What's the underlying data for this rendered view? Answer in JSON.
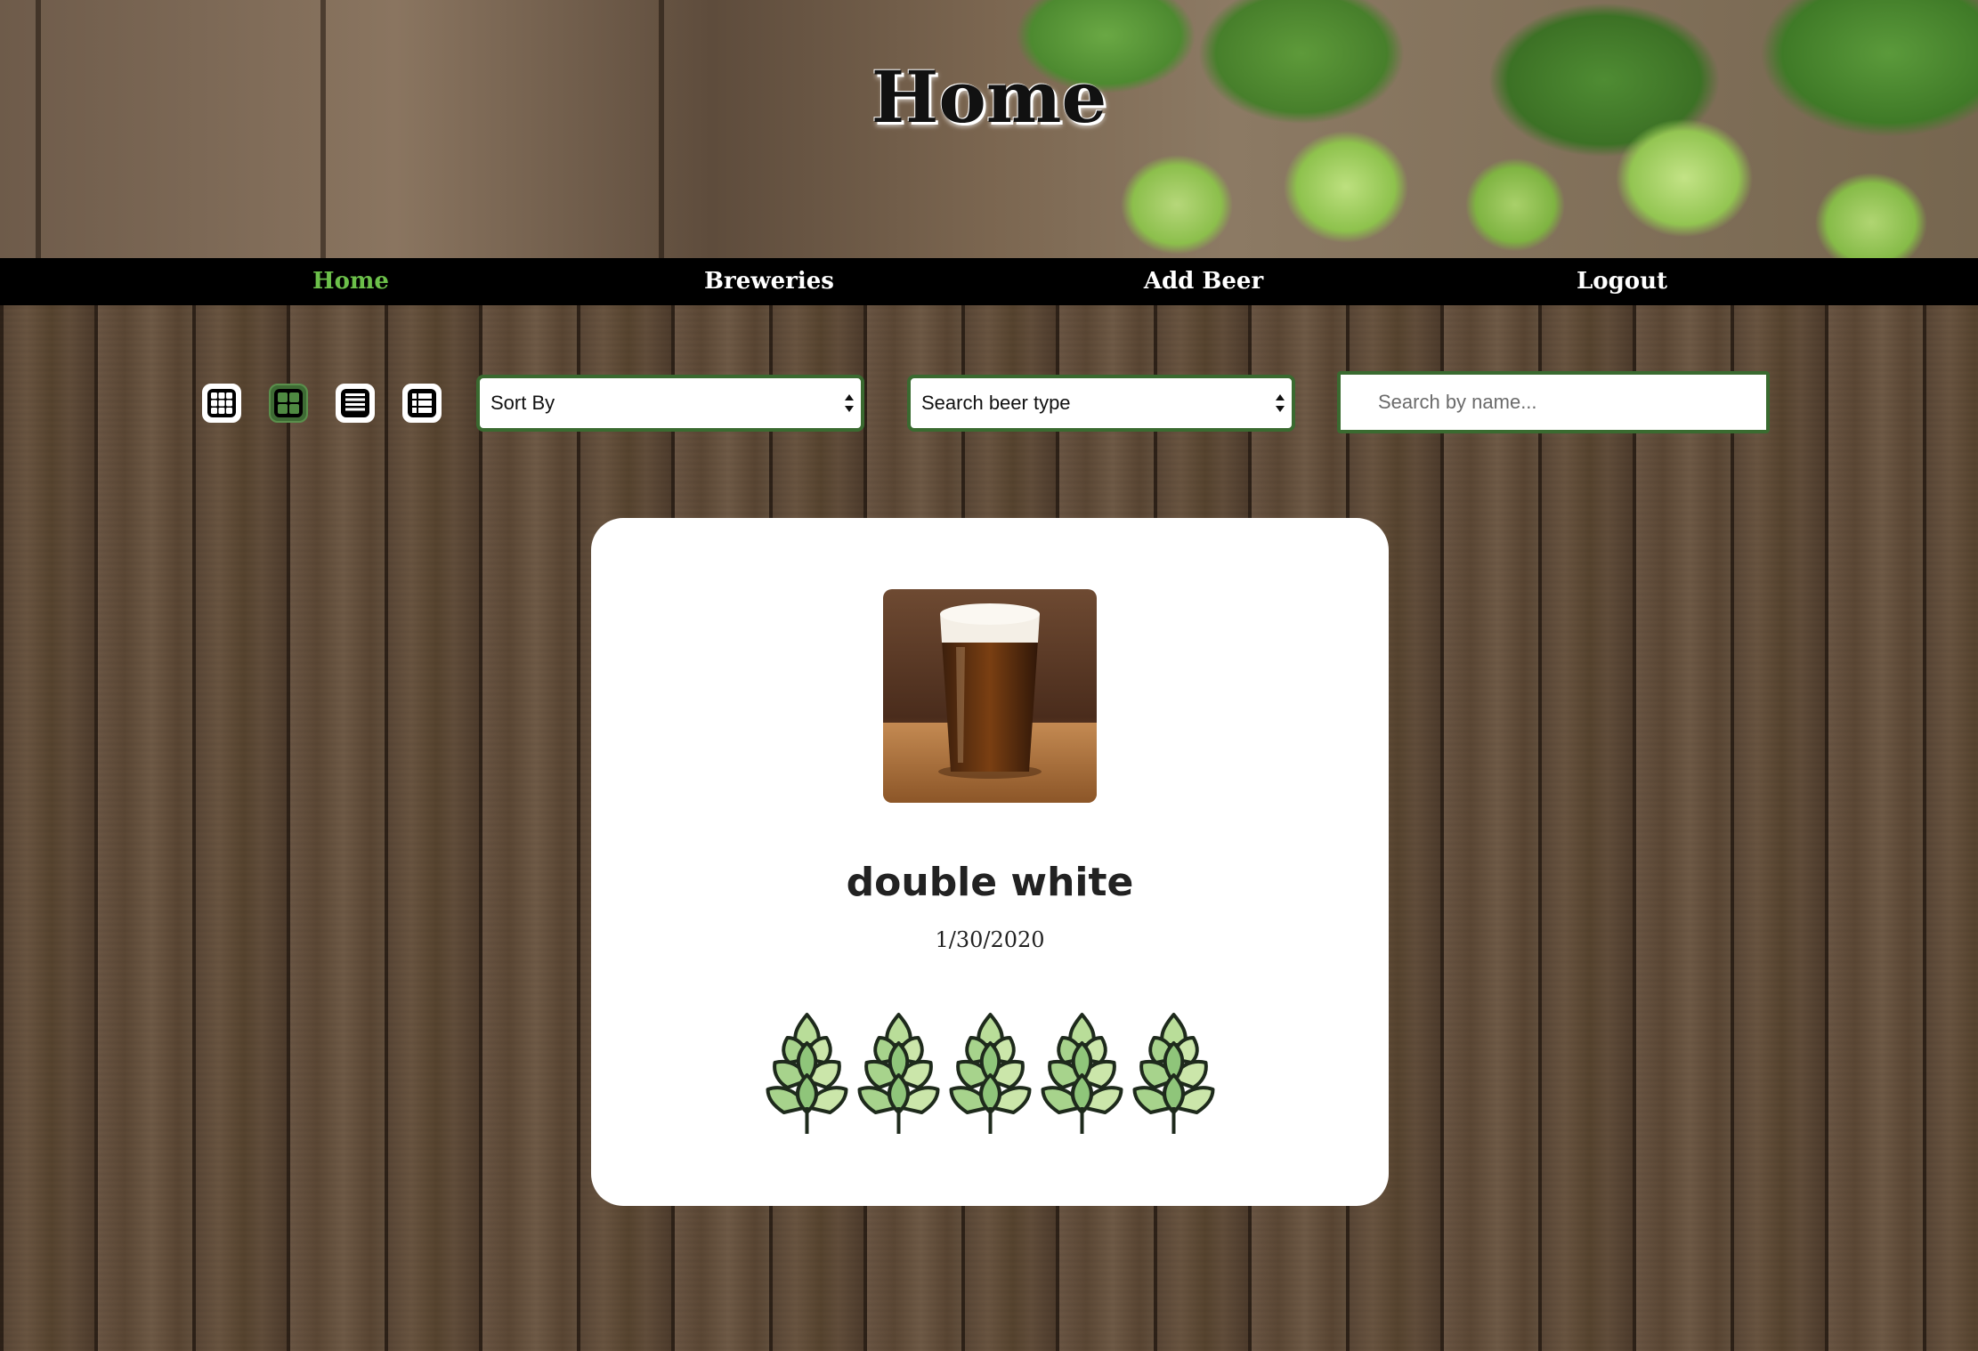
{
  "header": {
    "title": "Home"
  },
  "nav": {
    "items": [
      {
        "label": "Home",
        "active": true
      },
      {
        "label": "Breweries",
        "active": false
      },
      {
        "label": "Add Beer",
        "active": false
      },
      {
        "label": "Logout",
        "active": false
      }
    ]
  },
  "toolbar": {
    "view_modes": [
      {
        "icon": "grid-3x3-icon",
        "active": false
      },
      {
        "icon": "grid-2x2-icon",
        "active": true
      },
      {
        "icon": "list-lines-icon",
        "active": false
      },
      {
        "icon": "list-detail-icon",
        "active": false
      }
    ],
    "sort_select": {
      "value": "Sort By"
    },
    "type_select": {
      "value": "Search beer type"
    },
    "search": {
      "placeholder": "Search by name..."
    }
  },
  "card": {
    "image_icon": "beer-glass-image",
    "name": "double white",
    "date": "1/30/2020",
    "rating": {
      "value": 5,
      "max": 5,
      "icon": "hop-icon"
    }
  },
  "colors": {
    "accent_green": "#6cc04a",
    "border_green": "#3a6a30",
    "active_view_bg": "#3e6b34",
    "nav_bg": "#000000"
  }
}
